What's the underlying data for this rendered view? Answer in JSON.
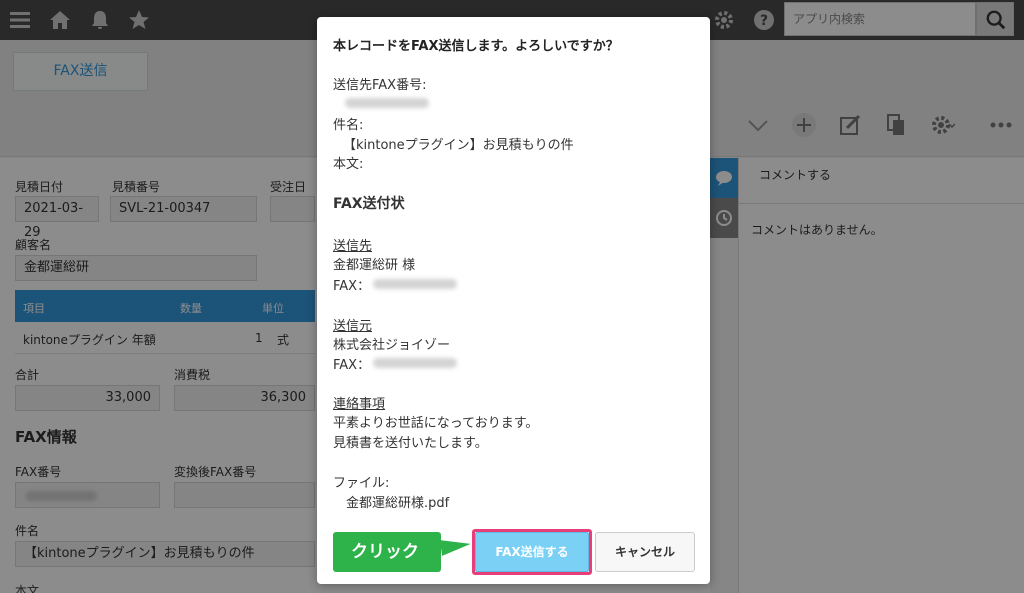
{
  "header": {
    "search_placeholder": "アプリ内検索",
    "icons": [
      "menu-icon",
      "home-icon",
      "bell-icon",
      "star-icon",
      "gear-icon",
      "help-icon",
      "search-icon"
    ]
  },
  "toolbar": {
    "fax_button_label": "FAX送信",
    "icons": [
      "chevron-down-icon",
      "add-icon",
      "edit-icon",
      "copy-icon",
      "gear-icon",
      "more-icon"
    ]
  },
  "form": {
    "estimate_date_label": "見積日付",
    "estimate_date_value": "2021-03-29",
    "estimate_no_label": "見積番号",
    "estimate_no_value": "SVL-21-00347",
    "order_date_label": "受注日",
    "customer_label": "顧客名",
    "customer_value": "金都運総研",
    "table_headers": [
      "項目",
      "数量",
      "単位"
    ],
    "table_row": [
      "kintoneプラグイン 年額",
      "1",
      "式"
    ],
    "total_label": "合計",
    "total_value": "33,000",
    "tax_label": "消費税",
    "tax_value": "36,300",
    "fax_section_title": "FAX情報",
    "fax_no_label": "FAX番号",
    "converted_fax_label": "変換後FAX番号",
    "subject_label": "件名",
    "subject_value": "【kintoneプラグイン】お見積もりの件",
    "body_label": "本文"
  },
  "sidepanel": {
    "comment_label": "コメントする",
    "no_comments": "コメントはありません。"
  },
  "dialog": {
    "title": "本レコードをFAX送信します。よろしいですか？",
    "dest_fax_label": "送信先FAX番号:",
    "subject_label": "件名:",
    "subject_value": "【kintoneプラグイン】お見積もりの件",
    "body_label": "本文:",
    "cover_title": "FAX送付状",
    "to_heading": "送信先",
    "to_name": "金都運総研 様",
    "to_fax": "FAX：",
    "from_heading": "送信元",
    "from_name": "株式会社ジョイゾー",
    "from_fax": "FAX：",
    "notes_heading": "連絡事項",
    "notes_line1": "平素よりお世話になっております。",
    "notes_line2": "見積書を送付いたします。",
    "file_label": "ファイル:",
    "file_name": "金都運総研様.pdf",
    "send_button": "FAX送信する",
    "cancel_button": "キャンセル"
  },
  "callout": {
    "label": "クリック"
  }
}
